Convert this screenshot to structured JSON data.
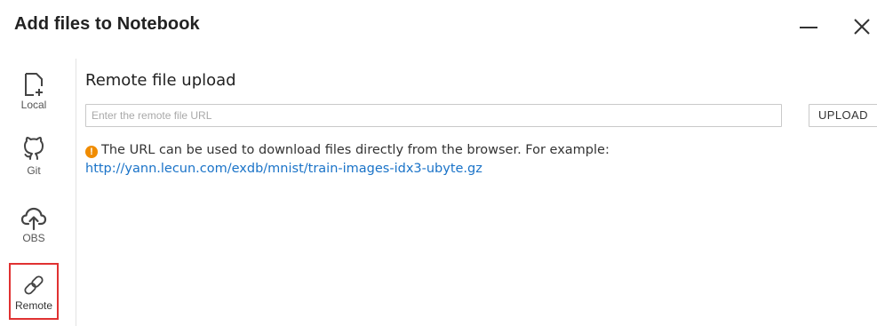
{
  "dialog": {
    "title": "Add files to Notebook",
    "minimize_icon": "minimize-icon",
    "close_icon": "close-icon"
  },
  "sidebar": {
    "items": [
      {
        "label": "Local",
        "icon": "add-file-icon"
      },
      {
        "label": "Git",
        "icon": "github-icon"
      },
      {
        "label": "OBS",
        "icon": "cloud-upload-icon"
      },
      {
        "label": "Remote",
        "icon": "link-icon",
        "selected": true
      }
    ]
  },
  "main": {
    "section_title": "Remote file upload",
    "url_input": {
      "placeholder": "Enter the remote file URL",
      "value": ""
    },
    "upload_label": "UPLOAD",
    "hint": {
      "icon": "warning-icon",
      "icon_glyph": "!",
      "text": "The URL can be used to download files directly from the browser. For example:",
      "link": "http://yann.lecun.com/exdb/mnist/train-images-idx3-ubyte.gz"
    }
  },
  "colors": {
    "selected_border": "#e03131",
    "warning": "#f08c00",
    "link": "#1a73c8"
  }
}
